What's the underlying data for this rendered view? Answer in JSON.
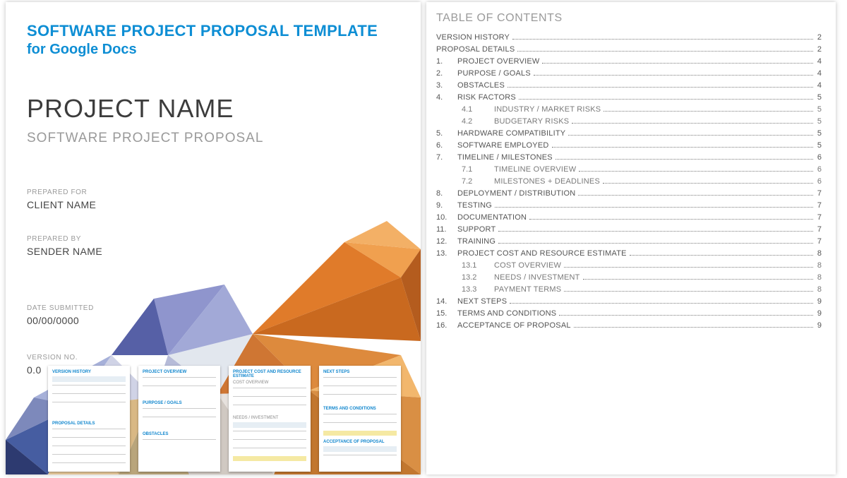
{
  "cover": {
    "title_line1": "SOFTWARE PROJECT PROPOSAL TEMPLATE",
    "title_line2": "for Google Docs",
    "project_name": "PROJECT NAME",
    "project_sub": "SOFTWARE PROJECT PROPOSAL",
    "fields": {
      "prepared_for_label": "PREPARED FOR",
      "prepared_for_value": "CLIENT NAME",
      "prepared_by_label": "PREPARED BY",
      "prepared_by_value": "SENDER NAME",
      "date_label": "DATE SUBMITTED",
      "date_value": "00/00/0000",
      "version_label": "VERSION NO.",
      "version_value": "0.0"
    }
  },
  "thumbnails": {
    "page2_hdr_a": "VERSION HISTORY",
    "page2_hdr_b": "PROPOSAL DETAILS",
    "page3_hdr_a": "PROJECT OVERVIEW",
    "page3_hdr_b": "PURPOSE / GOALS",
    "page3_hdr_c": "OBSTACLES",
    "page4_hdr_a": "PROJECT COST AND RESOURCE ESTIMATE",
    "page4_hdr_b": "COST OVERVIEW",
    "page4_hdr_c": "NEEDS / INVESTMENT",
    "page5_hdr_a": "NEXT STEPS",
    "page5_hdr_b": "TERMS AND CONDITIONS",
    "page5_hdr_c": "ACCEPTANCE OF PROPOSAL"
  },
  "toc": {
    "heading": "TABLE OF CONTENTS",
    "entries": [
      {
        "num": "",
        "label": "VERSION HISTORY",
        "page": "2",
        "level": 0,
        "noindent": true
      },
      {
        "num": "",
        "label": "PROPOSAL DETAILS",
        "page": "2",
        "level": 0,
        "noindent": true
      },
      {
        "num": "1.",
        "label": "PROJECT OVERVIEW",
        "page": "4",
        "level": 0
      },
      {
        "num": "2.",
        "label": "PURPOSE / GOALS",
        "page": "4",
        "level": 0
      },
      {
        "num": "3.",
        "label": "OBSTACLES",
        "page": "4",
        "level": 0
      },
      {
        "num": "4.",
        "label": "RISK FACTORS",
        "page": "5",
        "level": 0
      },
      {
        "num": "4.1",
        "label": "INDUSTRY / MARKET RISKS",
        "page": "5",
        "level": 1
      },
      {
        "num": "4.2",
        "label": "BUDGETARY RISKS",
        "page": "5",
        "level": 1
      },
      {
        "num": "5.",
        "label": "HARDWARE COMPATIBILITY",
        "page": "5",
        "level": 0
      },
      {
        "num": "6.",
        "label": "SOFTWARE EMPLOYED",
        "page": "5",
        "level": 0
      },
      {
        "num": "7.",
        "label": "TIMELINE / MILESTONES",
        "page": "6",
        "level": 0
      },
      {
        "num": "7.1",
        "label": "TIMELINE OVERVIEW",
        "page": "6",
        "level": 1
      },
      {
        "num": "7.2",
        "label": "MILESTONES + DEADLINES",
        "page": "6",
        "level": 1
      },
      {
        "num": "8.",
        "label": "DEPLOYMENT / DISTRIBUTION",
        "page": "7",
        "level": 0
      },
      {
        "num": "9.",
        "label": "TESTING",
        "page": "7",
        "level": 0
      },
      {
        "num": "10.",
        "label": "DOCUMENTATION",
        "page": "7",
        "level": 0
      },
      {
        "num": "11.",
        "label": "SUPPORT",
        "page": "7",
        "level": 0
      },
      {
        "num": "12.",
        "label": "TRAINING",
        "page": "7",
        "level": 0
      },
      {
        "num": "13.",
        "label": "PROJECT COST AND RESOURCE ESTIMATE",
        "page": "8",
        "level": 0
      },
      {
        "num": "13.1",
        "label": "COST OVERVIEW",
        "page": "8",
        "level": 1
      },
      {
        "num": "13.2",
        "label": "NEEDS / INVESTMENT",
        "page": "8",
        "level": 1
      },
      {
        "num": "13.3",
        "label": "PAYMENT TERMS",
        "page": "8",
        "level": 1
      },
      {
        "num": "14.",
        "label": "NEXT STEPS",
        "page": "9",
        "level": 0
      },
      {
        "num": "15.",
        "label": "TERMS AND CONDITIONS",
        "page": "9",
        "level": 0
      },
      {
        "num": "16.",
        "label": "ACCEPTANCE OF PROPOSAL",
        "page": "9",
        "level": 0
      }
    ]
  }
}
